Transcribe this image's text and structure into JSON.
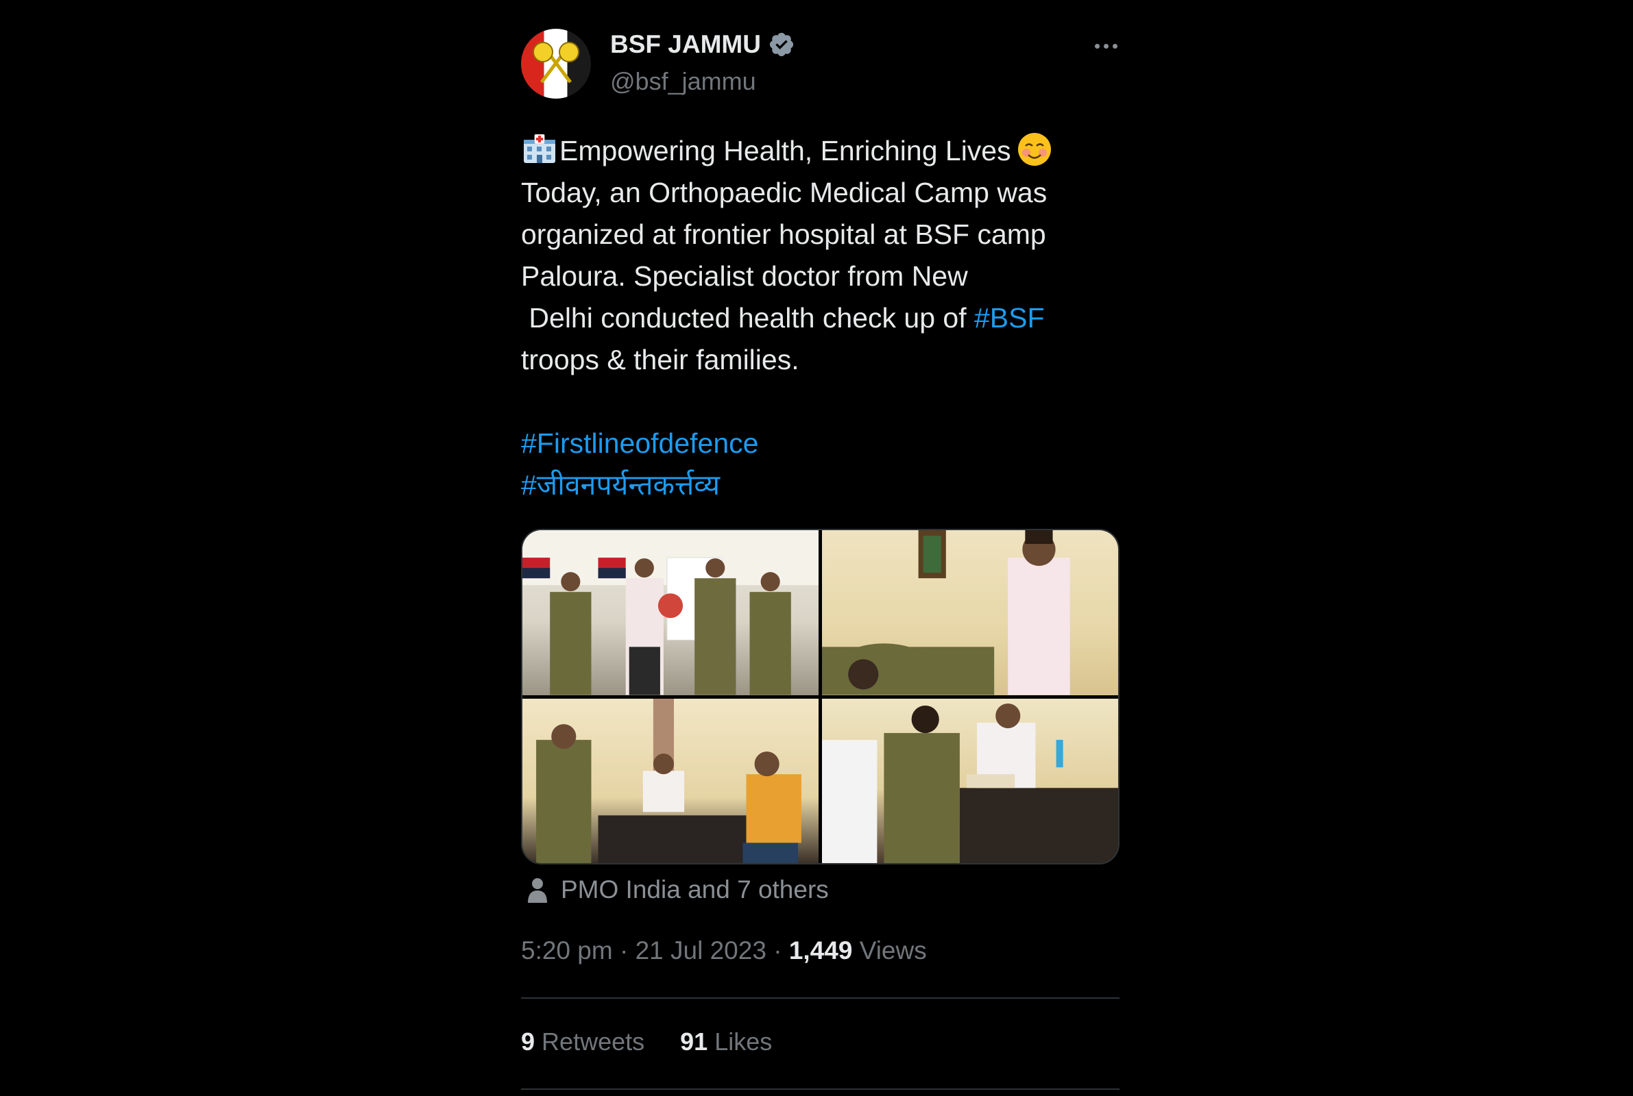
{
  "author": {
    "name": "BSF JAMMU",
    "handle": "@bsf_jammu",
    "verified": true
  },
  "tweet": {
    "line1": "Empowering Health, Enriching Lives",
    "body": "Today, an Orthopaedic Medical Camp was organized at frontier hospital at BSF camp Paloura. Specialist doctor from New\n Delhi conducted health check up of ",
    "hashtag_inline": "#BSF",
    "body_end": "troops & their families.",
    "hashtag_1": "#Firstlineofdefence",
    "hashtag_2": "#जीवनपर्यन्तकर्त्तव्य"
  },
  "tagged": "PMO India and 7 others",
  "meta": {
    "time": "5:20 pm",
    "date": "21 Jul 2023",
    "views_count": "1,449",
    "views_label": "Views"
  },
  "stats": {
    "retweets_count": "9",
    "retweets_label": "Retweets",
    "likes_count": "91",
    "likes_label": "Likes"
  },
  "colors": {
    "background": "#000000",
    "text": "#e7e9ea",
    "muted": "#71767b",
    "link": "#1d9bf0",
    "divider": "#2f3336"
  },
  "icons": [
    "verified-badge-icon",
    "more-options-icon",
    "hospital-emoji-icon",
    "smiling-emoji-icon",
    "person-icon"
  ]
}
